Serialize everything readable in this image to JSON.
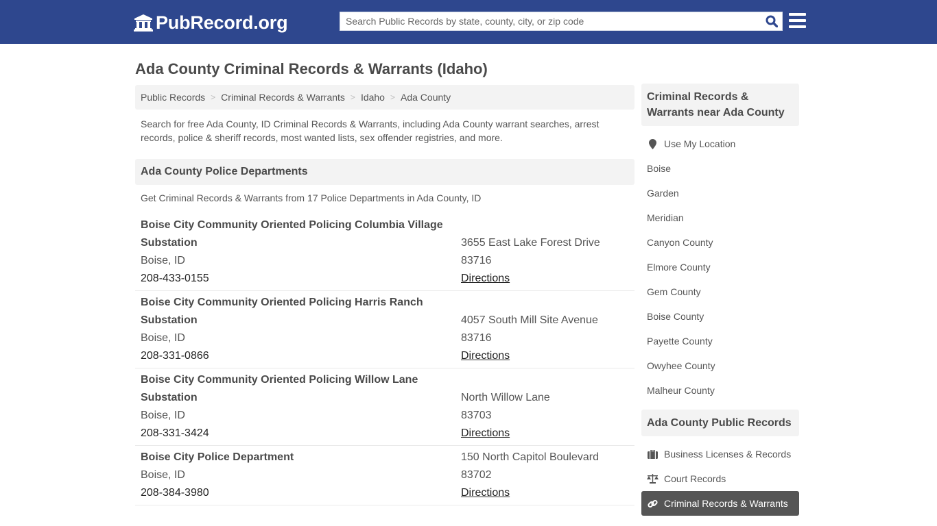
{
  "header": {
    "logo_text": "PubRecord.org",
    "logo_icon": "courthouse-icon",
    "search_placeholder": "Search Public Records by state, county, city, or zip code",
    "search_value": "",
    "search_icon": "search-icon",
    "menu_icon": "hamburger-menu-icon",
    "brand_color": "#2e478e"
  },
  "page": {
    "title": "Ada County Criminal Records & Warrants (Idaho)",
    "breadcrumb": [
      "Public Records",
      "Criminal Records & Warrants",
      "Idaho",
      "Ada County"
    ],
    "intro": "Search for free Ada County, ID Criminal Records & Warrants, including Ada County warrant searches, arrest records, police & sheriff records, most wanted lists, sex offender registries, and more."
  },
  "section": {
    "title": "Ada County Police Departments",
    "subtitle": "Get Criminal Records & Warrants from 17 Police Departments in Ada County, ID",
    "records": [
      {
        "name_line1": "Boise City Community Oriented Policing Columbia Village",
        "name_line2": "Substation",
        "city": "Boise, ID",
        "phone": "208-433-0155",
        "address": "3655 East Lake Forest Drive",
        "zip": "83716",
        "directions": "Directions"
      },
      {
        "name_line1": "Boise City Community Oriented Policing Harris Ranch",
        "name_line2": "Substation",
        "city": "Boise, ID",
        "phone": "208-331-0866",
        "address": "4057 South Mill Site Avenue",
        "zip": "83716",
        "directions": "Directions"
      },
      {
        "name_line1": "Boise City Community Oriented Policing Willow Lane",
        "name_line2": "Substation",
        "city": "Boise, ID",
        "phone": "208-331-3424",
        "address": "North Willow Lane",
        "zip": "83703",
        "directions": "Directions"
      },
      {
        "name_line1": "Boise City Police Department",
        "city": "Boise, ID",
        "phone": "208-384-3980",
        "address": "150 North Capitol Boulevard",
        "zip": "83702",
        "directions": "Directions"
      }
    ]
  },
  "sidebar": {
    "nearby_title": "Criminal Records & Warrants near Ada County",
    "use_location": "Use My Location",
    "nearby": [
      "Boise",
      "Garden",
      "Meridian",
      "Canyon County",
      "Elmore County",
      "Gem County",
      "Boise County",
      "Payette County",
      "Owyhee County",
      "Malheur County"
    ],
    "records_title": "Ada County Public Records",
    "records_links": [
      {
        "label": "Business Licenses & Records",
        "icon": "briefcase-icon",
        "active": false
      },
      {
        "label": "Court Records",
        "icon": "balance-scale-icon",
        "active": false
      },
      {
        "label": "Criminal Records & Warrants",
        "icon": "link-icon",
        "active": true
      }
    ]
  }
}
